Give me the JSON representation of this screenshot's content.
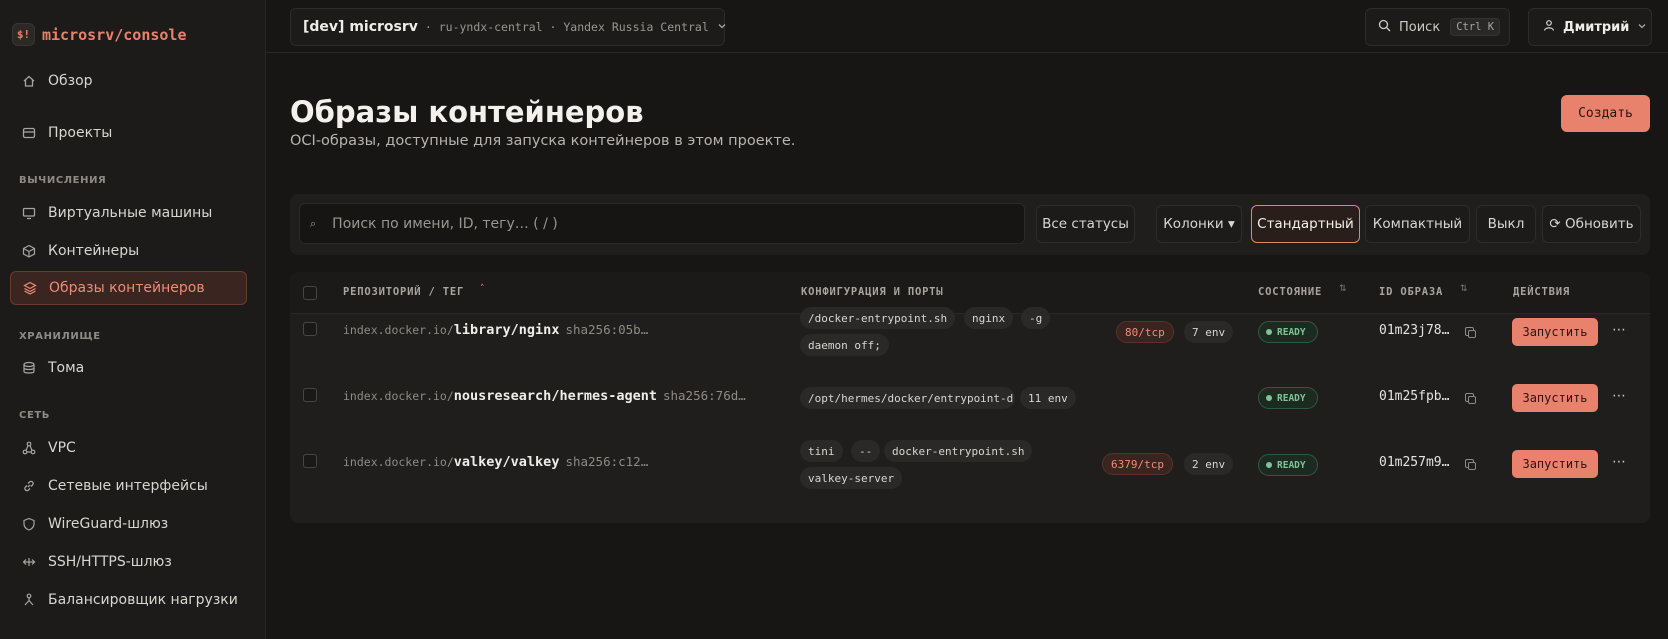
{
  "brand": {
    "logo": "$!",
    "name": "microsrv/console"
  },
  "sidebar": {
    "top_items": [
      {
        "label": "Обзор",
        "icon": "home-icon"
      },
      {
        "label": "Проекты",
        "icon": "folder-icon"
      }
    ],
    "sections": [
      {
        "title": "ВЫЧИСЛЕНИЯ",
        "items": [
          {
            "label": "Виртуальные машины",
            "icon": "monitor-icon"
          },
          {
            "label": "Контейнеры",
            "icon": "box-icon"
          },
          {
            "label": "Образы контейнеров",
            "icon": "layers-icon",
            "active": true
          }
        ]
      },
      {
        "title": "ХРАНИЛИЩЕ",
        "items": [
          {
            "label": "Тома",
            "icon": "database-icon"
          }
        ]
      },
      {
        "title": "СЕТЬ",
        "items": [
          {
            "label": "VPC",
            "icon": "network-icon"
          },
          {
            "label": "Сетевые интерфейсы",
            "icon": "link-icon"
          },
          {
            "label": "WireGuard-шлюз",
            "icon": "shield-icon"
          },
          {
            "label": "SSH/HTTPS-шлюз",
            "icon": "arrows-icon"
          },
          {
            "label": "Балансировщик нагрузки",
            "icon": "balancer-icon"
          }
        ]
      }
    ]
  },
  "topbar": {
    "project": "[dev] microsrv",
    "region": "· ru-yndx-central · Yandex Russia Central",
    "search_label": "Поиск",
    "search_shortcut": "Ctrl K",
    "user": "Дмитрий"
  },
  "header": {
    "title": "Образы контейнеров",
    "subtitle": "OCI-образы, доступные для запуска контейнеров в этом проекте.",
    "create": "Создать"
  },
  "toolbar": {
    "search_placeholder": "Поиск по имени, ID, тегу…  ( / )",
    "status_filter": "Все статусы",
    "columns": "Колонки ▾",
    "density_standard": "Стандартный",
    "density_compact": "Компактный",
    "off": "Выкл",
    "refresh": "⟳ Обновить"
  },
  "table": {
    "columns": {
      "repo": "РЕПОЗИТОРИЙ / ТЕГ",
      "config": "КОНФИГУРАЦИЯ И ПОРТЫ",
      "state": "СОСТОЯНИЕ",
      "image_id": "ID ОБРАЗА",
      "actions": "ДЕЙСТВИЯ"
    },
    "rows": [
      {
        "prefix": "index.docker.io/",
        "name": "library/nginx",
        "digest": "sha256:05b…",
        "cmd": [
          "/docker-entrypoint.sh",
          "nginx",
          "-g",
          "daemon off;"
        ],
        "port": "80/tcp",
        "env": "7 env",
        "status": "READY",
        "image_id": "01m23j78…",
        "action": "Запустить"
      },
      {
        "prefix": "index.docker.io/",
        "name": "nousresearch/hermes-agent",
        "digest": "sha256:76d…",
        "cmd": [
          "/opt/hermes/docker/entrypoint-d:"
        ],
        "port": "",
        "env": "11 env",
        "status": "READY",
        "image_id": "01m25fpb…",
        "action": "Запустить"
      },
      {
        "prefix": "index.docker.io/",
        "name": "valkey/valkey",
        "digest": "sha256:c12…",
        "cmd": [
          "tini",
          "--",
          "docker-entrypoint.sh",
          "valkey-server"
        ],
        "port": "6379/tcp",
        "env": "2 env",
        "status": "READY",
        "image_id": "01m257m9…",
        "action": "Запустить"
      }
    ]
  }
}
